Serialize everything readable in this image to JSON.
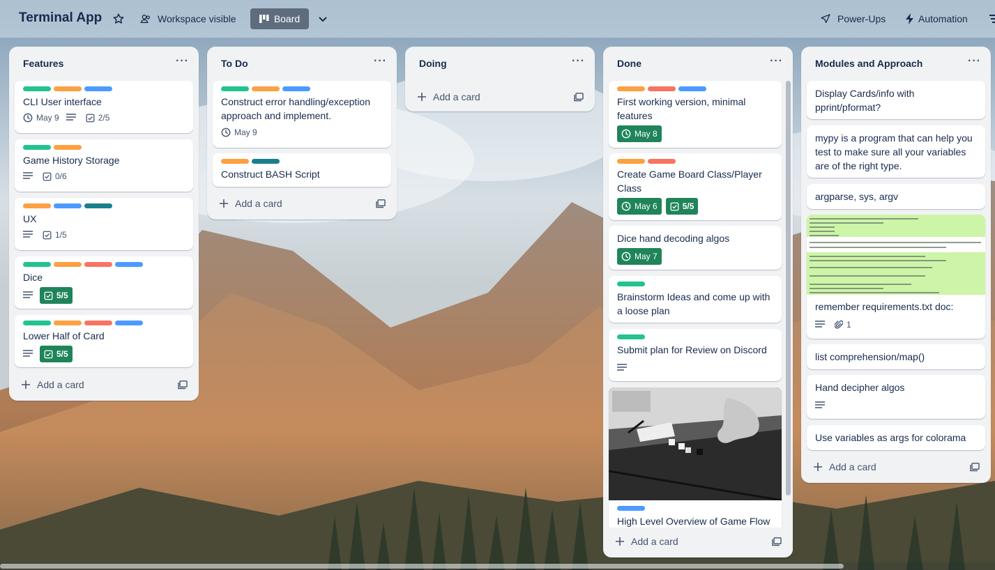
{
  "board": {
    "title": "Terminal App",
    "visibility": "Workspace visible",
    "view": "Board",
    "power_ups": "Power-Ups",
    "automation": "Automation"
  },
  "colors": {
    "green": "#22c38e",
    "orange": "#fca042",
    "red": "#f87462",
    "blue": "#4c9aff",
    "teal": "#1a7f8c"
  },
  "lists": [
    {
      "title": "Features",
      "add_card": "Add a card",
      "cards": [
        {
          "title": "CLI User interface",
          "labels": [
            "green",
            "orange",
            "blue"
          ],
          "date": "May 9",
          "description": true,
          "checklist": "2/5"
        },
        {
          "title": "Game History Storage",
          "labels": [
            "green",
            "orange"
          ],
          "description": true,
          "checklist": "0/6"
        },
        {
          "title": "UX",
          "labels": [
            "orange",
            "blue",
            "teal"
          ],
          "description": true,
          "checklist": "1/5"
        },
        {
          "title": "Dice",
          "labels": [
            "green",
            "orange",
            "red",
            "blue"
          ],
          "description": true,
          "checklist": "5/5",
          "checklist_complete": true
        },
        {
          "title": "Lower Half of Card",
          "labels": [
            "green",
            "orange",
            "red",
            "blue"
          ],
          "description": true,
          "checklist": "5/5",
          "checklist_complete": true
        }
      ]
    },
    {
      "title": "To Do",
      "add_card": "Add a card",
      "cards": [
        {
          "title": "Construct error handling/exception approach and implement.",
          "labels": [
            "green",
            "orange",
            "blue"
          ],
          "date": "May 9"
        },
        {
          "title": "Construct BASH Script",
          "labels": [
            "orange",
            "teal"
          ]
        }
      ]
    },
    {
      "title": "Doing",
      "add_card": "Add a card",
      "cards": []
    },
    {
      "title": "Done",
      "add_card": "Add a card",
      "cards": [
        {
          "title": "First working version, minimal features",
          "labels": [
            "orange",
            "red",
            "blue"
          ],
          "date": "May 8",
          "date_complete": true
        },
        {
          "title": "Create Game Board Class/Player Class",
          "labels": [
            "orange",
            "red"
          ],
          "date": "May 6",
          "date_complete": true,
          "checklist": "5/5",
          "checklist_complete": true
        },
        {
          "title": "Dice hand decoding algos",
          "date": "May 7",
          "date_complete": true
        },
        {
          "title": "Brainstorm Ideas and come up with a loose plan",
          "labels": [
            "green"
          ]
        },
        {
          "title": "Submit plan for Review on Discord",
          "labels": [
            "green"
          ],
          "description": true
        },
        {
          "title": "High Level Overview of Game Flow",
          "labels": [
            "blue"
          ],
          "cover": "dice-photo"
        }
      ]
    },
    {
      "title": "Modules and Approach",
      "add_card": "Add a card",
      "cards": [
        {
          "title": "Display Cards/info with pprint/pformat?"
        },
        {
          "title": "mypy is a program that can help you test to make sure all your variables are of the right type."
        },
        {
          "title": "argparse, sys, argv"
        },
        {
          "title": "remember requirements.txt doc:",
          "cover": "code-screenshot",
          "description": true,
          "attachments": "1"
        },
        {
          "title": "list comprehension/map()"
        },
        {
          "title": "Hand decipher algos",
          "description": true
        },
        {
          "title": "Use variables as args for colorama"
        }
      ]
    }
  ]
}
